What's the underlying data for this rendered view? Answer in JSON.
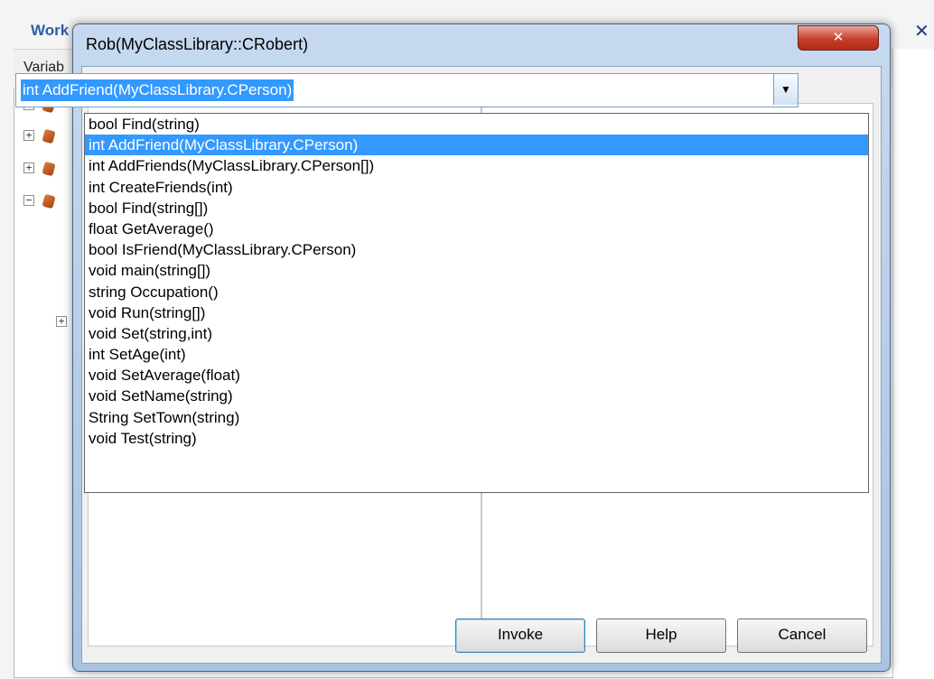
{
  "background": {
    "title": "Work",
    "close_glyph": "✕",
    "tab_label": "Variab",
    "tree_expanders": [
      "+",
      "+",
      "+",
      "−",
      "+"
    ]
  },
  "dialog": {
    "title": "Rob(MyClassLibrary::CRobert)",
    "close_glyph": "✕",
    "combo": {
      "selected_value": "int AddFriend(MyClassLibrary.CPerson)",
      "dropdown_icon": "chevron-down-icon",
      "dropdown_glyph": "▼"
    },
    "methods": [
      {
        "label": "bool Find(string)",
        "selected": false
      },
      {
        "label": "int AddFriend(MyClassLibrary.CPerson)",
        "selected": true
      },
      {
        "label": "int AddFriends(MyClassLibrary.CPerson[])",
        "selected": false
      },
      {
        "label": "int CreateFriends(int)",
        "selected": false
      },
      {
        "label": "bool Find(string[])",
        "selected": false
      },
      {
        "label": "float GetAverage()",
        "selected": false
      },
      {
        "label": "bool IsFriend(MyClassLibrary.CPerson)",
        "selected": false
      },
      {
        "label": "void main(string[])",
        "selected": false
      },
      {
        "label": "string Occupation()",
        "selected": false
      },
      {
        "label": "void Run(string[])",
        "selected": false
      },
      {
        "label": "void Set(string,int)",
        "selected": false
      },
      {
        "label": "int SetAge(int)",
        "selected": false
      },
      {
        "label": "void SetAverage(float)",
        "selected": false
      },
      {
        "label": "void SetName(string)",
        "selected": false
      },
      {
        "label": "String SetTown(string)",
        "selected": false
      },
      {
        "label": "void Test(string)",
        "selected": false
      }
    ],
    "buttons": {
      "invoke": "Invoke",
      "help": "Help",
      "cancel": "Cancel"
    }
  },
  "colors": {
    "selection": "#3399ff",
    "close_button": "#c7402c",
    "dialog_frame": "#b9cfe9"
  }
}
